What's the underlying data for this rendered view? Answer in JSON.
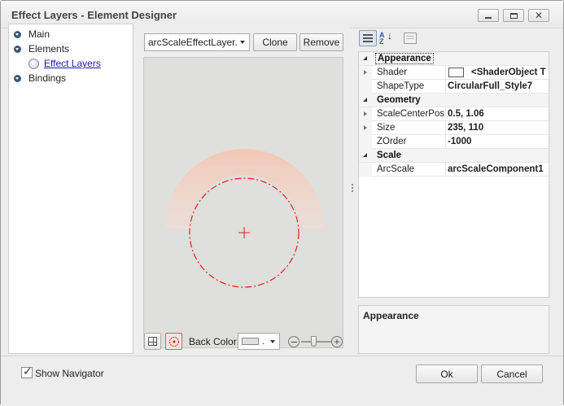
{
  "window": {
    "title": "Effect Layers - Element Designer"
  },
  "tree": {
    "items": [
      {
        "label": "Main"
      },
      {
        "label": "Elements"
      },
      {
        "label": "Effect Layers"
      },
      {
        "label": "Bindings"
      }
    ]
  },
  "toolbar": {
    "layer_select": "arcScaleEffectLayer...",
    "clone_label": "Clone",
    "remove_label": "Remove"
  },
  "preview": {
    "back_color_label": "Back Color:",
    "back_color_value": "."
  },
  "properties": {
    "rows": [
      {
        "type": "category",
        "name": "Appearance"
      },
      {
        "type": "prop",
        "name": "Shader",
        "value": "<ShaderObject T",
        "expandable": true,
        "swatch": true
      },
      {
        "type": "prop",
        "name": "ShapeType",
        "value": "CircularFull_Style7",
        "expandable": false
      },
      {
        "type": "category",
        "name": "Geometry"
      },
      {
        "type": "prop",
        "name": "ScaleCenterPos",
        "value": "0.5, 1.06",
        "expandable": true
      },
      {
        "type": "prop",
        "name": "Size",
        "value": "235, 110",
        "expandable": true
      },
      {
        "type": "prop",
        "name": "ZOrder",
        "value": "-1000",
        "expandable": false
      },
      {
        "type": "category",
        "name": "Scale"
      },
      {
        "type": "prop",
        "name": "ArcScale",
        "value": "arcScaleComponent1",
        "expandable": false
      }
    ],
    "description_title": "Appearance"
  },
  "footer": {
    "show_navigator_label": "Show Navigator",
    "show_navigator_checked": true,
    "ok_label": "Ok",
    "cancel_label": "Cancel"
  },
  "colors": {
    "accent_red": "#e02020",
    "effect_fill": "#f3cbbd"
  }
}
